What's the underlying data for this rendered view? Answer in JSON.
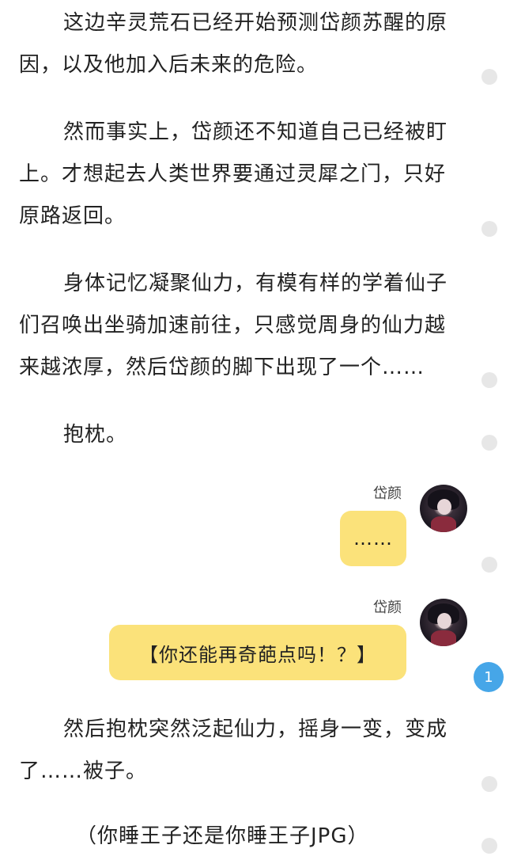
{
  "paragraphs": [
    "这边辛灵荒石已经开始预测岱颜苏醒的原因，以及他加入后未来的危险。",
    "然而事实上，岱颜还不知道自己已经被盯上。才想起去人类世界要通过灵犀之门，只好原路返回。",
    "身体记忆凝聚仙力，有模有样的学着仙子们召唤出坐骑加速前往，只感觉周身的仙力越来越浓厚，然后岱颜的脚下出现了一个……",
    "抱枕。",
    "然后抱枕突然泛起仙力，摇身一变，变成了……被子。",
    "（你睡王子还是你睡王子JPG）"
  ],
  "chat": [
    {
      "sender": "岱颜",
      "message": "……"
    },
    {
      "sender": "岱颜",
      "message": "【你还能再奇葩点吗！？】"
    }
  ],
  "badge": {
    "count": "1"
  },
  "colors": {
    "bubble": "#fbe27a",
    "badge": "#46a6e8",
    "dot": "#e7e7e7"
  }
}
